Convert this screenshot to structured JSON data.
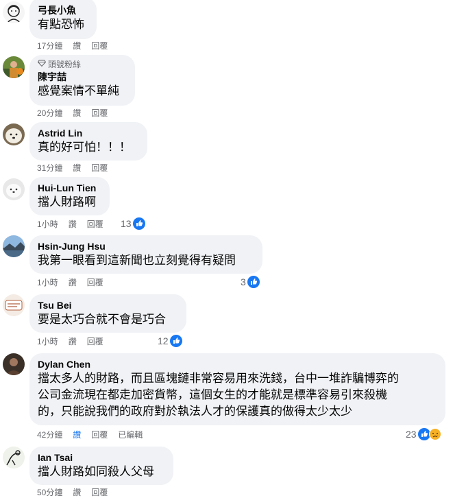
{
  "comments": [
    {
      "name": "弓長小魚",
      "badge": "",
      "text": [
        "有點恐怖"
      ],
      "time": "17分鐘",
      "like": "讚",
      "reply": "回覆",
      "edited": "",
      "reactions": "",
      "avatar": "face-sketch"
    },
    {
      "name": "陳宇喆",
      "badge": "頭號粉絲",
      "text": [
        "感覺案情不單純"
      ],
      "time": "20分鐘",
      "like": "讚",
      "reply": "回覆",
      "edited": "",
      "reactions": "",
      "avatar": "person-outdoor"
    },
    {
      "name": "Astrid Lin",
      "badge": "",
      "text": [
        "真的好可怕！！！"
      ],
      "time": "31分鐘",
      "like": "讚",
      "reply": "回覆",
      "edited": "",
      "reactions": "",
      "avatar": "white-dog"
    },
    {
      "name": "Hui-Lun Tien",
      "badge": "",
      "text": [
        "擋人財路啊"
      ],
      "time": "1小時",
      "like": "讚",
      "reply": "回覆",
      "edited": "",
      "reactions": "13",
      "avatar": "white-dog-2"
    },
    {
      "name": "Hsin-Jung Hsu",
      "badge": "",
      "text": [
        "我第一眼看到這新聞也立刻覺得有疑問"
      ],
      "time": "1小時",
      "like": "讚",
      "reply": "回覆",
      "edited": "",
      "reactions": "3",
      "avatar": "landscape"
    },
    {
      "name": "Tsu Bei",
      "badge": "",
      "text": [
        "要是太巧合就不會是巧合"
      ],
      "time": "1小時",
      "like": "讚",
      "reply": "回覆",
      "edited": "",
      "reactions": "12",
      "avatar": "sign"
    },
    {
      "name": "Dylan Chen",
      "badge": "",
      "text": [
        "擋太多人的財路，而且區塊鏈非常容易用來洗錢，台中一堆詐騙博弈的",
        "公司金流現在都走加密貨幣，這個女生的才能就是標準容易引來殺機",
        "的，只能說我們的政府對於執法人才的保護真的做得太少太少"
      ],
      "time": "42分鐘",
      "like": "讚",
      "reply": "回覆",
      "edited": "已編輯",
      "reactions": "23",
      "avatar": "person-dark"
    },
    {
      "name": "Ian Tsai",
      "badge": "",
      "text": [
        "擋人財路如同殺人父母"
      ],
      "time": "50分鐘",
      "like": "讚",
      "reply": "回覆",
      "edited": "",
      "reactions": "",
      "avatar": "figure-sketch"
    }
  ],
  "colors": {
    "like_blue": "#1877f2",
    "bubble": "#f0f2f5",
    "meta": "#65676b"
  }
}
